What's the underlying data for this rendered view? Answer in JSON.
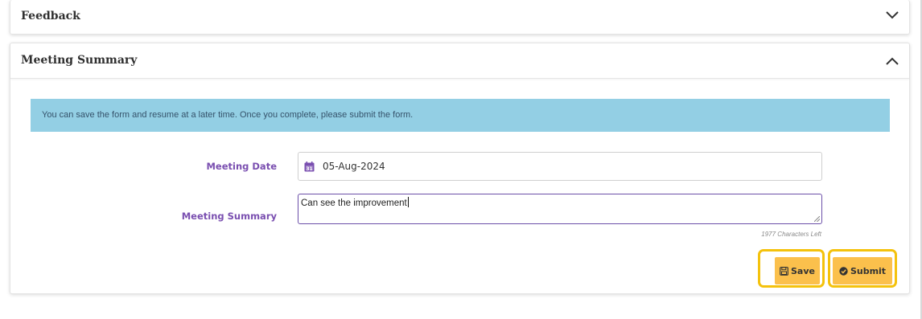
{
  "sections": {
    "feedback": {
      "title": "Feedback",
      "expanded": false
    },
    "meeting_summary": {
      "title": "Meeting Summary",
      "expanded": true
    }
  },
  "info_banner": "You can save the form and resume at a later time. Once you complete, please submit the form.",
  "form": {
    "meeting_date_label": "Meeting Date",
    "meeting_date_value": "05-Aug-2024",
    "meeting_summary_label": "Meeting Summary",
    "meeting_summary_value": "Can see the improvement",
    "characters_left": "1977 Characters Left"
  },
  "buttons": {
    "save": "Save",
    "submit": "Submit"
  },
  "icons": [
    "chevron-down-icon",
    "chevron-up-icon",
    "calendar-icon",
    "save-icon",
    "check-circle-icon",
    "resize-grip-icon"
  ],
  "colors": {
    "info_bg": "#93cfe4",
    "label": "#7a4fb0",
    "button": "#fbc04c",
    "highlight": "#f4c20d",
    "textarea_border": "#6b4fa8"
  }
}
